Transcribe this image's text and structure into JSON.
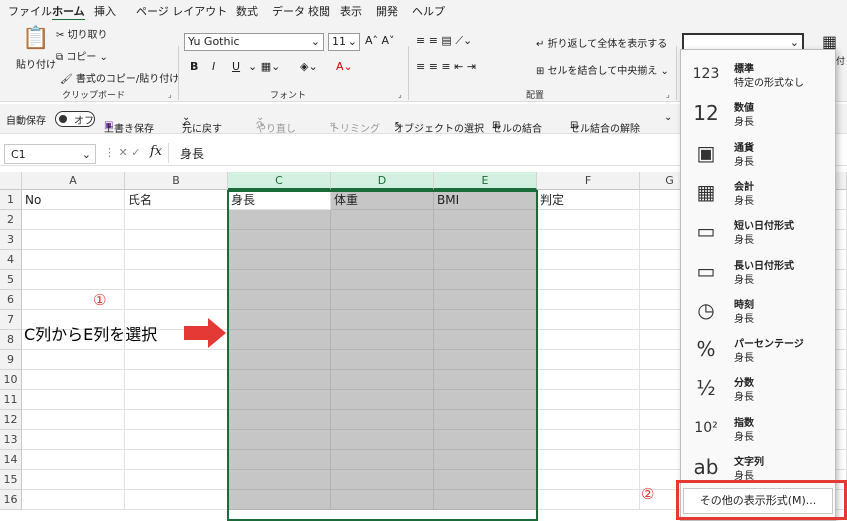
{
  "menu": {
    "tabs": [
      "ファイル",
      "ホーム",
      "挿入",
      "ページ レイアウト",
      "数式",
      "データ",
      "校閲",
      "表示",
      "開発",
      "ヘルプ"
    ]
  },
  "clipboard": {
    "paste": "貼り付け",
    "cut": "切り取り",
    "copy": "コピー",
    "format_painter": "書式のコピー/貼り付け",
    "label": "クリップボード"
  },
  "font": {
    "name": "Yu Gothic",
    "size": "11",
    "bold": "B",
    "italic": "I",
    "underline": "U",
    "label": "フォント"
  },
  "align": {
    "wrap": "折り返して全体を表示する",
    "merge": "セルを結合して中央揃え",
    "label": "配置"
  },
  "qat": {
    "autosave": "自動保存",
    "toggle": "オフ",
    "save": "上書き保存",
    "undo": "元に戻す",
    "redo": "やり直し",
    "trim": "トリミング",
    "select_obj": "オブジェクトの選択",
    "merge_cells": "セルの結合",
    "unmerge": "セル結合の解除"
  },
  "formula": {
    "namebox": "C1",
    "fx": "fx",
    "content": "身長"
  },
  "columns": [
    "A",
    "B",
    "C",
    "D",
    "E",
    "F",
    "G"
  ],
  "rows": [
    "1",
    "2",
    "3",
    "4",
    "5",
    "6",
    "7",
    "8",
    "9",
    "10",
    "11",
    "12",
    "13",
    "14",
    "15",
    "16"
  ],
  "cells": {
    "A1": "No",
    "B1": "氏名",
    "C1": "身長",
    "D1": "体重",
    "E1": "BMI",
    "F1": "判定"
  },
  "format_menu": {
    "items": [
      {
        "name": "標準",
        "value": "特定の形式なし",
        "icon": "clock-123-icon",
        "glyph": "123"
      },
      {
        "name": "数値",
        "value": "身長",
        "icon": "number-icon",
        "glyph": "12"
      },
      {
        "name": "通貨",
        "value": "身長",
        "icon": "currency-icon",
        "glyph": "▣"
      },
      {
        "name": "会計",
        "value": "身長",
        "icon": "calculator-icon",
        "glyph": "▦"
      },
      {
        "name": "短い日付形式",
        "value": "身長",
        "icon": "calendar-icon",
        "glyph": "▭"
      },
      {
        "name": "長い日付形式",
        "value": "身長",
        "icon": "calendar-long-icon",
        "glyph": "▭"
      },
      {
        "name": "時刻",
        "value": "身長",
        "icon": "clock-icon",
        "glyph": "◷"
      },
      {
        "name": "パーセンテージ",
        "value": "身長",
        "icon": "percent-icon",
        "glyph": "%"
      },
      {
        "name": "分数",
        "value": "身長",
        "icon": "fraction-icon",
        "glyph": "½"
      },
      {
        "name": "指数",
        "value": "身長",
        "icon": "exponent-icon",
        "glyph": "10²"
      },
      {
        "name": "文字列",
        "value": "身長",
        "icon": "text-icon",
        "glyph": "ab"
      }
    ],
    "more": "その他の表示形式(M)..."
  },
  "annotation": {
    "step1": "①",
    "step2": "②",
    "note": "C列からE列を選択"
  },
  "colors": {
    "accent": "#1b6b3a",
    "highlight": "#e53935"
  }
}
